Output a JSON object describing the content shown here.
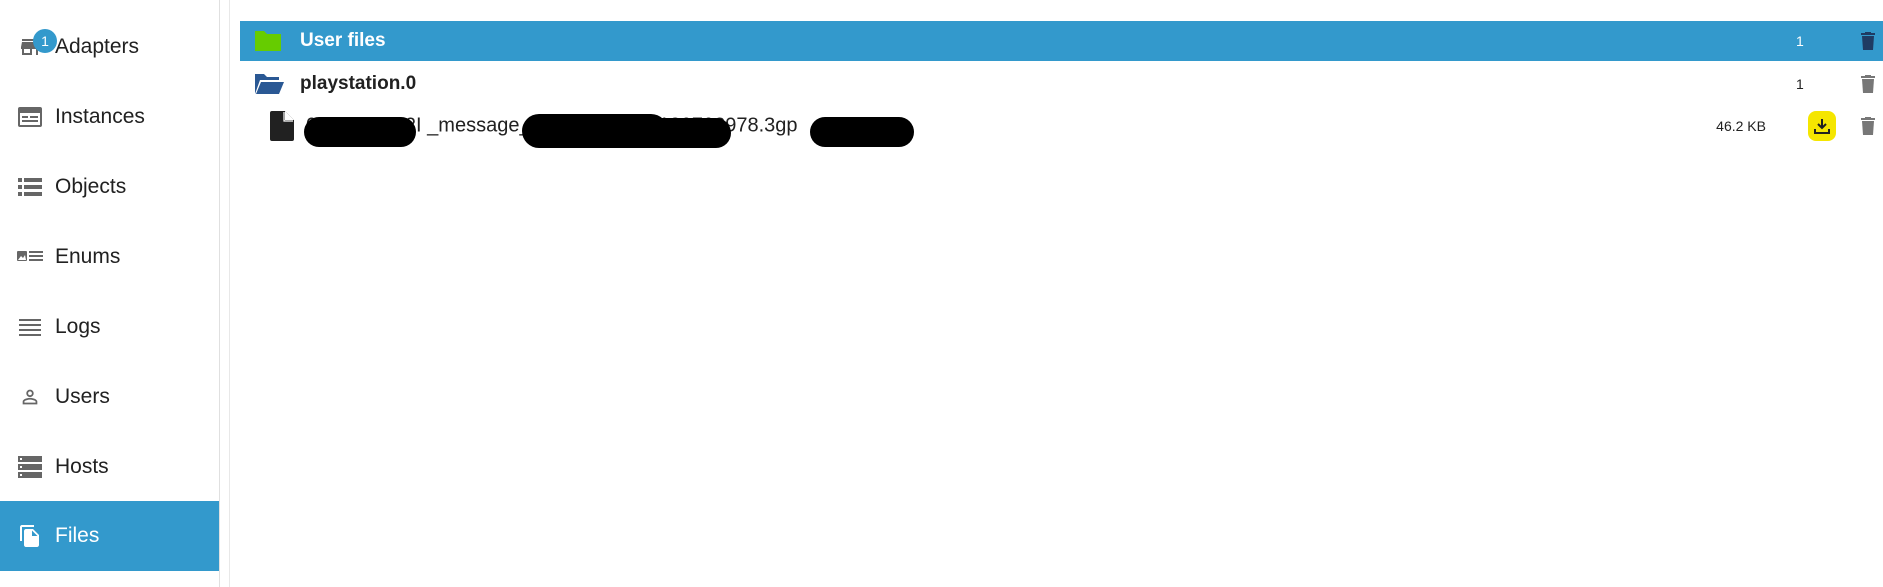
{
  "sidebar": {
    "items": [
      {
        "label": "Adapters",
        "icon": "store-icon",
        "badge": "1"
      },
      {
        "label": "Instances",
        "icon": "instances-icon"
      },
      {
        "label": "Objects",
        "icon": "list-icon"
      },
      {
        "label": "Enums",
        "icon": "enums-icon"
      },
      {
        "label": "Logs",
        "icon": "logs-icon"
      },
      {
        "label": "Users",
        "icon": "user-icon"
      },
      {
        "label": "Hosts",
        "icon": "hosts-icon"
      },
      {
        "label": "Files",
        "icon": "files-icon",
        "active": true
      }
    ]
  },
  "files": {
    "header": {
      "name": "User files",
      "count": "1",
      "icon": "folder-icon"
    },
    "folder": {
      "name": "playstation.0",
      "count": "1",
      "icon": "folder-open-icon"
    },
    "file": {
      "name": "0F264CBD2I                         _message_3                    18575_1555180703978.3gp",
      "size": "46.2 KB",
      "icon": "file-icon"
    }
  },
  "colors": {
    "accent": "#3399cc",
    "folder_green": "#66cc00",
    "folder_blue": "#2a5894",
    "download_yellow": "#f5e600"
  }
}
